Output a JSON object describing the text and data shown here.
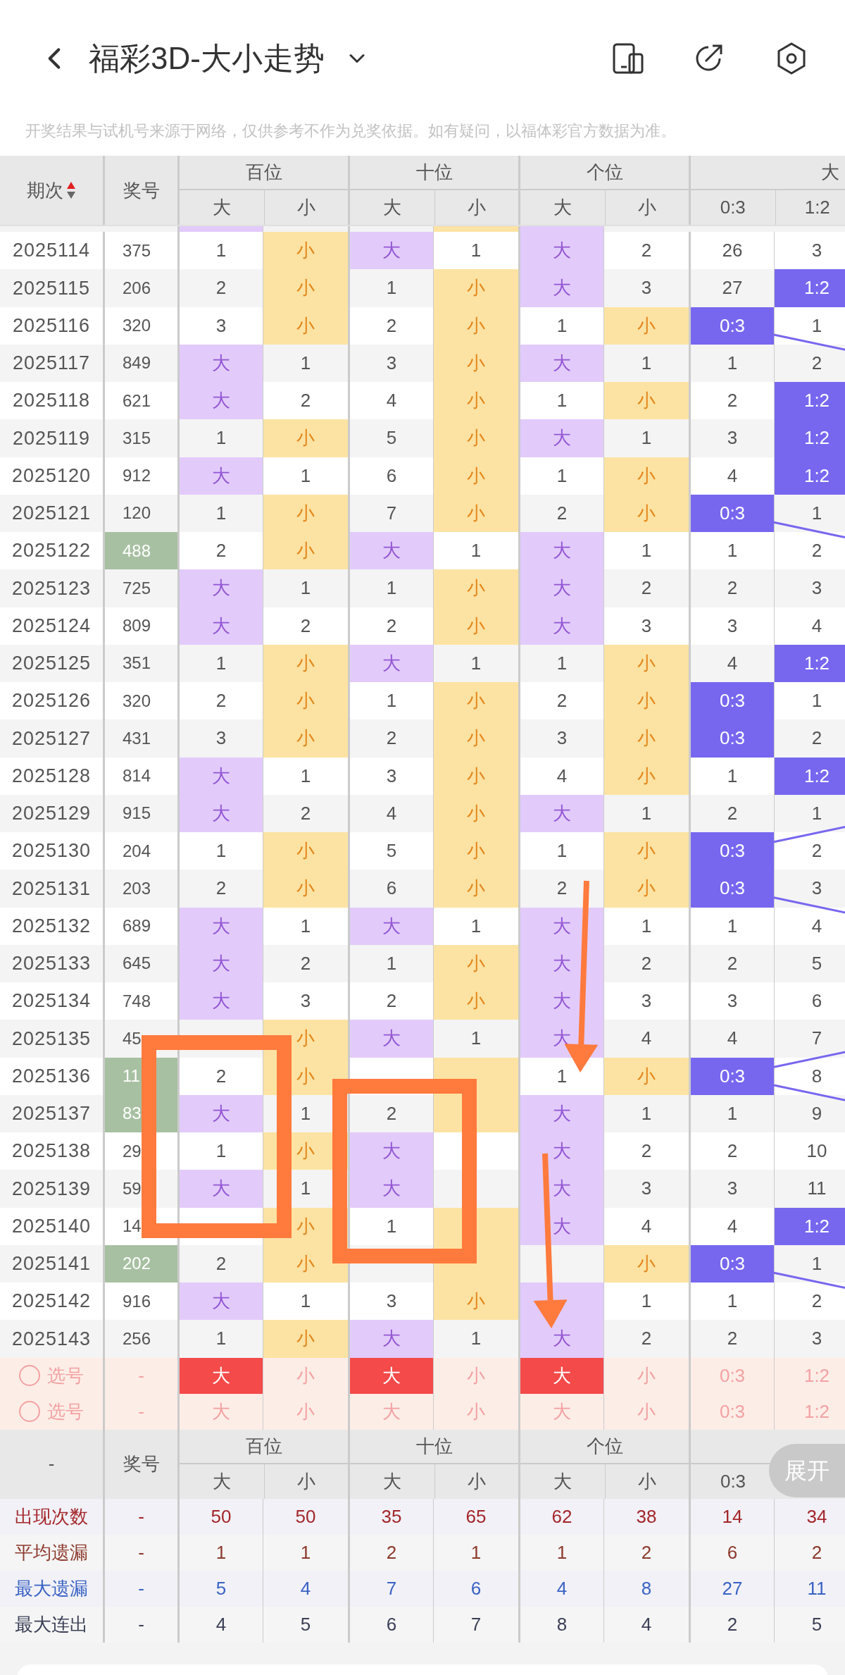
{
  "header": {
    "title": "福彩3D-大小走势",
    "notice": "开奖结果与试机号来源于网络，仅供参考不作为兑奖依据。如有疑问，以福体彩官方数据为准。"
  },
  "table": {
    "issue_heading": "期次",
    "sort_ascending": true,
    "number_heading": "奖号",
    "groups": [
      {
        "title": "百位",
        "subs": [
          "大",
          "小"
        ]
      },
      {
        "title": "十位",
        "subs": [
          "大",
          "小"
        ]
      },
      {
        "title": "个位",
        "subs": [
          "大",
          "小"
        ]
      },
      {
        "title": "大",
        "subs": [
          "0:3",
          "1:2"
        ]
      }
    ],
    "partial_row": {
      "hits": [
        true,
        false,
        false,
        true,
        true,
        false
      ]
    },
    "rows": [
      {
        "issue": "2025114",
        "number": "375",
        "pair": false,
        "cells": [
          {
            "text": "1",
            "hit": false
          },
          {
            "text": "小",
            "hit": true
          },
          {
            "text": "大",
            "hit": true
          },
          {
            "text": "1",
            "hit": false
          },
          {
            "text": "大",
            "hit": true
          },
          {
            "text": "2",
            "hit": false
          },
          {
            "text": "26",
            "hit": false
          },
          {
            "text": "3",
            "hit": false
          }
        ]
      },
      {
        "issue": "2025115",
        "number": "206",
        "pair": false,
        "cells": [
          {
            "text": "2",
            "hit": false
          },
          {
            "text": "小",
            "hit": true
          },
          {
            "text": "1",
            "hit": false
          },
          {
            "text": "小",
            "hit": true
          },
          {
            "text": "大",
            "hit": true
          },
          {
            "text": "3",
            "hit": false
          },
          {
            "text": "27",
            "hit": false
          },
          {
            "text": "1:2",
            "hit": true
          }
        ]
      },
      {
        "issue": "2025116",
        "number": "320",
        "pair": false,
        "cells": [
          {
            "text": "3",
            "hit": false
          },
          {
            "text": "小",
            "hit": true
          },
          {
            "text": "2",
            "hit": false
          },
          {
            "text": "小",
            "hit": true
          },
          {
            "text": "1",
            "hit": false
          },
          {
            "text": "小",
            "hit": true
          },
          {
            "text": "0:3",
            "hit": true
          },
          {
            "text": "1",
            "hit": false
          }
        ]
      },
      {
        "issue": "2025117",
        "number": "849",
        "pair": false,
        "cells": [
          {
            "text": "大",
            "hit": true
          },
          {
            "text": "1",
            "hit": false
          },
          {
            "text": "3",
            "hit": false
          },
          {
            "text": "小",
            "hit": true
          },
          {
            "text": "大",
            "hit": true
          },
          {
            "text": "1",
            "hit": false
          },
          {
            "text": "1",
            "hit": false
          },
          {
            "text": "2",
            "hit": false
          }
        ]
      },
      {
        "issue": "2025118",
        "number": "621",
        "pair": false,
        "cells": [
          {
            "text": "大",
            "hit": true
          },
          {
            "text": "2",
            "hit": false
          },
          {
            "text": "4",
            "hit": false
          },
          {
            "text": "小",
            "hit": true
          },
          {
            "text": "1",
            "hit": false
          },
          {
            "text": "小",
            "hit": true
          },
          {
            "text": "2",
            "hit": false
          },
          {
            "text": "1:2",
            "hit": true
          }
        ]
      },
      {
        "issue": "2025119",
        "number": "315",
        "pair": false,
        "cells": [
          {
            "text": "1",
            "hit": false
          },
          {
            "text": "小",
            "hit": true
          },
          {
            "text": "5",
            "hit": false
          },
          {
            "text": "小",
            "hit": true
          },
          {
            "text": "大",
            "hit": true
          },
          {
            "text": "1",
            "hit": false
          },
          {
            "text": "3",
            "hit": false
          },
          {
            "text": "1:2",
            "hit": true
          }
        ]
      },
      {
        "issue": "2025120",
        "number": "912",
        "pair": false,
        "cells": [
          {
            "text": "大",
            "hit": true
          },
          {
            "text": "1",
            "hit": false
          },
          {
            "text": "6",
            "hit": false
          },
          {
            "text": "小",
            "hit": true
          },
          {
            "text": "1",
            "hit": false
          },
          {
            "text": "小",
            "hit": true
          },
          {
            "text": "4",
            "hit": false
          },
          {
            "text": "1:2",
            "hit": true
          }
        ]
      },
      {
        "issue": "2025121",
        "number": "120",
        "pair": false,
        "cells": [
          {
            "text": "1",
            "hit": false
          },
          {
            "text": "小",
            "hit": true
          },
          {
            "text": "7",
            "hit": false
          },
          {
            "text": "小",
            "hit": true
          },
          {
            "text": "2",
            "hit": false
          },
          {
            "text": "小",
            "hit": true
          },
          {
            "text": "0:3",
            "hit": true
          },
          {
            "text": "1",
            "hit": false
          }
        ]
      },
      {
        "issue": "2025122",
        "number": "488",
        "pair": true,
        "cells": [
          {
            "text": "2",
            "hit": false
          },
          {
            "text": "小",
            "hit": true
          },
          {
            "text": "大",
            "hit": true
          },
          {
            "text": "1",
            "hit": false
          },
          {
            "text": "大",
            "hit": true
          },
          {
            "text": "1",
            "hit": false
          },
          {
            "text": "1",
            "hit": false
          },
          {
            "text": "2",
            "hit": false
          }
        ]
      },
      {
        "issue": "2025123",
        "number": "725",
        "pair": false,
        "cells": [
          {
            "text": "大",
            "hit": true
          },
          {
            "text": "1",
            "hit": false
          },
          {
            "text": "1",
            "hit": false
          },
          {
            "text": "小",
            "hit": true
          },
          {
            "text": "大",
            "hit": true
          },
          {
            "text": "2",
            "hit": false
          },
          {
            "text": "2",
            "hit": false
          },
          {
            "text": "3",
            "hit": false
          }
        ]
      },
      {
        "issue": "2025124",
        "number": "809",
        "pair": false,
        "cells": [
          {
            "text": "大",
            "hit": true
          },
          {
            "text": "2",
            "hit": false
          },
          {
            "text": "2",
            "hit": false
          },
          {
            "text": "小",
            "hit": true
          },
          {
            "text": "大",
            "hit": true
          },
          {
            "text": "3",
            "hit": false
          },
          {
            "text": "3",
            "hit": false
          },
          {
            "text": "4",
            "hit": false
          }
        ]
      },
      {
        "issue": "2025125",
        "number": "351",
        "pair": false,
        "cells": [
          {
            "text": "1",
            "hit": false
          },
          {
            "text": "小",
            "hit": true
          },
          {
            "text": "大",
            "hit": true
          },
          {
            "text": "1",
            "hit": false
          },
          {
            "text": "1",
            "hit": false
          },
          {
            "text": "小",
            "hit": true
          },
          {
            "text": "4",
            "hit": false
          },
          {
            "text": "1:2",
            "hit": true
          }
        ]
      },
      {
        "issue": "2025126",
        "number": "320",
        "pair": false,
        "cells": [
          {
            "text": "2",
            "hit": false
          },
          {
            "text": "小",
            "hit": true
          },
          {
            "text": "1",
            "hit": false
          },
          {
            "text": "小",
            "hit": true
          },
          {
            "text": "2",
            "hit": false
          },
          {
            "text": "小",
            "hit": true
          },
          {
            "text": "0:3",
            "hit": true
          },
          {
            "text": "1",
            "hit": false
          }
        ]
      },
      {
        "issue": "2025127",
        "number": "431",
        "pair": false,
        "cells": [
          {
            "text": "3",
            "hit": false
          },
          {
            "text": "小",
            "hit": true
          },
          {
            "text": "2",
            "hit": false
          },
          {
            "text": "小",
            "hit": true
          },
          {
            "text": "3",
            "hit": false
          },
          {
            "text": "小",
            "hit": true
          },
          {
            "text": "0:3",
            "hit": true
          },
          {
            "text": "2",
            "hit": false
          }
        ]
      },
      {
        "issue": "2025128",
        "number": "814",
        "pair": false,
        "cells": [
          {
            "text": "大",
            "hit": true
          },
          {
            "text": "1",
            "hit": false
          },
          {
            "text": "3",
            "hit": false
          },
          {
            "text": "小",
            "hit": true
          },
          {
            "text": "4",
            "hit": false
          },
          {
            "text": "小",
            "hit": true
          },
          {
            "text": "1",
            "hit": false
          },
          {
            "text": "1:2",
            "hit": true
          }
        ]
      },
      {
        "issue": "2025129",
        "number": "915",
        "pair": false,
        "cells": [
          {
            "text": "大",
            "hit": true
          },
          {
            "text": "2",
            "hit": false
          },
          {
            "text": "4",
            "hit": false
          },
          {
            "text": "小",
            "hit": true
          },
          {
            "text": "大",
            "hit": true
          },
          {
            "text": "1",
            "hit": false
          },
          {
            "text": "2",
            "hit": false
          },
          {
            "text": "1",
            "hit": false
          }
        ]
      },
      {
        "issue": "2025130",
        "number": "204",
        "pair": false,
        "cells": [
          {
            "text": "1",
            "hit": false
          },
          {
            "text": "小",
            "hit": true
          },
          {
            "text": "5",
            "hit": false
          },
          {
            "text": "小",
            "hit": true
          },
          {
            "text": "1",
            "hit": false
          },
          {
            "text": "小",
            "hit": true
          },
          {
            "text": "0:3",
            "hit": true
          },
          {
            "text": "2",
            "hit": false
          }
        ]
      },
      {
        "issue": "2025131",
        "number": "203",
        "pair": false,
        "cells": [
          {
            "text": "2",
            "hit": false
          },
          {
            "text": "小",
            "hit": true
          },
          {
            "text": "6",
            "hit": false
          },
          {
            "text": "小",
            "hit": true
          },
          {
            "text": "2",
            "hit": false
          },
          {
            "text": "小",
            "hit": true
          },
          {
            "text": "0:3",
            "hit": true
          },
          {
            "text": "3",
            "hit": false
          }
        ]
      },
      {
        "issue": "2025132",
        "number": "689",
        "pair": false,
        "cells": [
          {
            "text": "大",
            "hit": true
          },
          {
            "text": "1",
            "hit": false
          },
          {
            "text": "大",
            "hit": true
          },
          {
            "text": "1",
            "hit": false
          },
          {
            "text": "大",
            "hit": true
          },
          {
            "text": "1",
            "hit": false
          },
          {
            "text": "1",
            "hit": false
          },
          {
            "text": "4",
            "hit": false
          }
        ]
      },
      {
        "issue": "2025133",
        "number": "645",
        "pair": false,
        "cells": [
          {
            "text": "大",
            "hit": true
          },
          {
            "text": "2",
            "hit": false
          },
          {
            "text": "1",
            "hit": false
          },
          {
            "text": "小",
            "hit": true
          },
          {
            "text": "大",
            "hit": true
          },
          {
            "text": "2",
            "hit": false
          },
          {
            "text": "2",
            "hit": false
          },
          {
            "text": "5",
            "hit": false
          }
        ]
      },
      {
        "issue": "2025134",
        "number": "748",
        "pair": false,
        "cells": [
          {
            "text": "大",
            "hit": true
          },
          {
            "text": "3",
            "hit": false
          },
          {
            "text": "2",
            "hit": false
          },
          {
            "text": "小",
            "hit": true
          },
          {
            "text": "大",
            "hit": true
          },
          {
            "text": "3",
            "hit": false
          },
          {
            "text": "3",
            "hit": false
          },
          {
            "text": "6",
            "hit": false
          }
        ]
      },
      {
        "issue": "2025135",
        "number": "45",
        "pair": false,
        "cells": [
          {
            "hit": false
          },
          {
            "text": "小",
            "hit": true
          },
          {
            "text": "大",
            "hit": true
          },
          {
            "text": "1",
            "hit": false
          },
          {
            "text": "大",
            "hit": true
          },
          {
            "text": "4",
            "hit": false
          },
          {
            "text": "4",
            "hit": false
          },
          {
            "text": "7",
            "hit": false
          }
        ]
      },
      {
        "issue": "2025136",
        "number": "11",
        "pair": true,
        "cells": [
          {
            "text": "2",
            "hit": false
          },
          {
            "text": "小",
            "hit": true
          },
          {
            "hit": false
          },
          {
            "hit": true
          },
          {
            "text": "1",
            "hit": false
          },
          {
            "text": "小",
            "hit": true
          },
          {
            "text": "0:3",
            "hit": true
          },
          {
            "text": "8",
            "hit": false
          }
        ]
      },
      {
        "issue": "2025137",
        "number": "83",
        "pair": true,
        "cells": [
          {
            "text": "大",
            "hit": true
          },
          {
            "text": "1",
            "hit": false
          },
          {
            "text": "2",
            "hit": false
          },
          {
            "hit": true
          },
          {
            "text": "大",
            "hit": true
          },
          {
            "text": "1",
            "hit": false
          },
          {
            "text": "1",
            "hit": false
          },
          {
            "text": "9",
            "hit": false
          }
        ]
      },
      {
        "issue": "2025138",
        "number": "29",
        "pair": false,
        "cells": [
          {
            "text": "1",
            "hit": false
          },
          {
            "text": "小",
            "hit": true
          },
          {
            "text": "大",
            "hit": true
          },
          {
            "hit": false
          },
          {
            "text": "大",
            "hit": true
          },
          {
            "text": "2",
            "hit": false
          },
          {
            "text": "2",
            "hit": false
          },
          {
            "text": "10",
            "hit": false
          }
        ]
      },
      {
        "issue": "2025139",
        "number": "59",
        "pair": false,
        "cells": [
          {
            "text": "大",
            "hit": true
          },
          {
            "text": "1",
            "hit": false
          },
          {
            "text": "大",
            "hit": true
          },
          {
            "hit": false
          },
          {
            "text": "大",
            "hit": true
          },
          {
            "text": "3",
            "hit": false
          },
          {
            "text": "3",
            "hit": false
          },
          {
            "text": "11",
            "hit": false
          }
        ]
      },
      {
        "issue": "2025140",
        "number": "14",
        "pair": false,
        "cells": [
          {
            "hit": false
          },
          {
            "text": "小",
            "hit": true
          },
          {
            "text": "1",
            "hit": false
          },
          {
            "hit": true
          },
          {
            "text": "大",
            "hit": true
          },
          {
            "text": "4",
            "hit": false
          },
          {
            "text": "4",
            "hit": false
          },
          {
            "text": "1:2",
            "hit": true
          }
        ]
      },
      {
        "issue": "2025141",
        "number": "202",
        "pair": true,
        "cells": [
          {
            "text": "2",
            "hit": false
          },
          {
            "text": "小",
            "hit": true
          },
          {
            "hit": false
          },
          {
            "hit": true
          },
          {
            "hit": false
          },
          {
            "text": "小",
            "hit": true
          },
          {
            "text": "0:3",
            "hit": true
          },
          {
            "text": "1",
            "hit": false
          }
        ]
      },
      {
        "issue": "2025142",
        "number": "916",
        "pair": false,
        "cells": [
          {
            "text": "大",
            "hit": true
          },
          {
            "text": "1",
            "hit": false
          },
          {
            "text": "3",
            "hit": false
          },
          {
            "text": "小",
            "hit": true
          },
          {
            "hit": true
          },
          {
            "text": "1",
            "hit": false
          },
          {
            "text": "1",
            "hit": false
          },
          {
            "text": "2",
            "hit": false
          }
        ]
      },
      {
        "issue": "2025143",
        "number": "256",
        "pair": false,
        "cells": [
          {
            "text": "1",
            "hit": false
          },
          {
            "text": "小",
            "hit": true
          },
          {
            "text": "大",
            "hit": true
          },
          {
            "text": "1",
            "hit": false
          },
          {
            "text": "大",
            "hit": true
          },
          {
            "text": "2",
            "hit": false
          },
          {
            "text": "2",
            "hit": false
          },
          {
            "text": "3",
            "hit": false
          }
        ]
      }
    ],
    "pick_rows": [
      {
        "label": "选号",
        "checked": false,
        "number": "-",
        "cells": [
          {
            "text": "大",
            "selected": true
          },
          {
            "text": "小",
            "selected": false
          },
          {
            "text": "大",
            "selected": true
          },
          {
            "text": "小",
            "selected": false
          },
          {
            "text": "大",
            "selected": true
          },
          {
            "text": "小",
            "selected": false
          },
          {
            "text": "0:3",
            "selected": false
          },
          {
            "text": "1:2",
            "selected": false
          }
        ]
      },
      {
        "label": "选号",
        "checked": false,
        "number": "-",
        "cells": [
          {
            "text": "大",
            "selected": false
          },
          {
            "text": "小",
            "selected": false
          },
          {
            "text": "大",
            "selected": false
          },
          {
            "text": "小",
            "selected": false
          },
          {
            "text": "大",
            "selected": false
          },
          {
            "text": "小",
            "selected": false
          },
          {
            "text": "0:3",
            "selected": false
          },
          {
            "text": "1:2",
            "selected": false
          }
        ]
      }
    ],
    "summary_header": {
      "issue": "-",
      "number": "奖号",
      "groups": [
        {
          "title": "百位",
          "subs": [
            "大",
            "小"
          ]
        },
        {
          "title": "十位",
          "subs": [
            "大",
            "小"
          ]
        },
        {
          "title": "个位",
          "subs": [
            "大",
            "小"
          ]
        },
        {
          "subs": [
            "0:3"
          ]
        }
      ],
      "expand_button": "展开"
    },
    "stats": [
      {
        "label": "出现次数",
        "color": "#a3262a",
        "number": "-",
        "values": [
          "50",
          "50",
          "35",
          "65",
          "62",
          "38",
          "14",
          "34"
        ]
      },
      {
        "label": "平均遗漏",
        "color": "#8c3a2c",
        "number": "-",
        "values": [
          "1",
          "1",
          "2",
          "1",
          "1",
          "2",
          "6",
          "2"
        ]
      },
      {
        "label": "最大遗漏",
        "color": "#3a62c4",
        "number": "-",
        "values": [
          "5",
          "4",
          "7",
          "6",
          "4",
          "8",
          "27",
          "11"
        ]
      },
      {
        "label": "最大连出",
        "color": "#3a3f55",
        "number": "-",
        "values": [
          "4",
          "5",
          "6",
          "7",
          "8",
          "4",
          "2",
          "5"
        ]
      }
    ]
  },
  "annotations": [
    {
      "kind": "rectangle"
    },
    {
      "kind": "rectangle"
    },
    {
      "kind": "arrow"
    },
    {
      "kind": "arrow"
    }
  ]
}
